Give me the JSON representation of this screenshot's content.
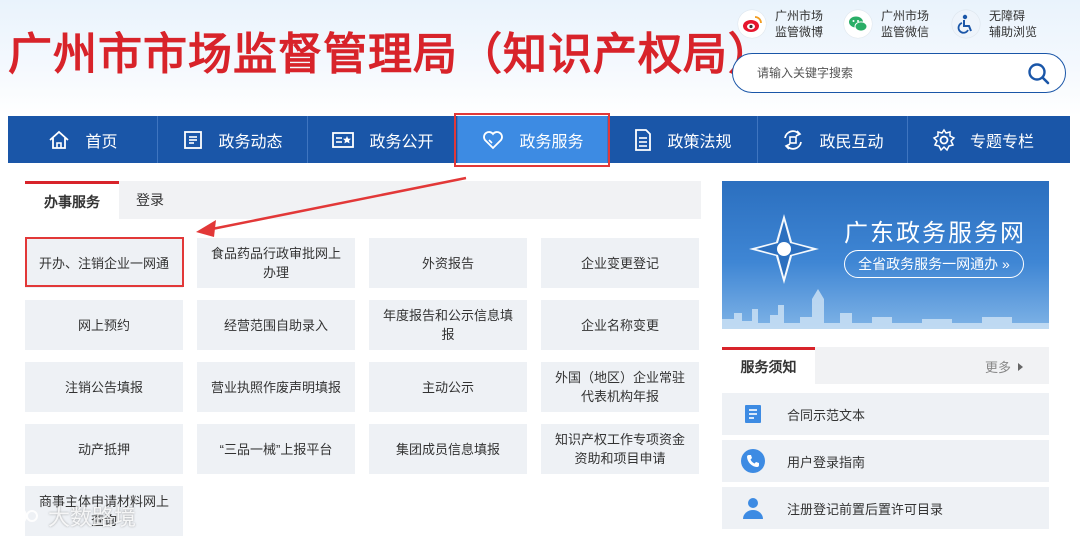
{
  "header": {
    "site_title": "广州市市场监督管理局（知识产权局）",
    "links": [
      {
        "line1": "广州市场",
        "line2": "监管微博",
        "icon": "weibo-icon"
      },
      {
        "line1": "广州市场",
        "line2": "监管微信",
        "icon": "wechat-icon"
      },
      {
        "line1": "无障碍",
        "line2": "辅助浏览",
        "icon": "accessibility-icon"
      }
    ],
    "search_placeholder": "请输入关键字搜索"
  },
  "nav": {
    "items": [
      {
        "label": "首页",
        "icon": "home-icon"
      },
      {
        "label": "政务动态",
        "icon": "news-icon"
      },
      {
        "label": "政务公开",
        "icon": "publicity-icon"
      },
      {
        "label": "政务服务",
        "icon": "heart-icon",
        "active": true
      },
      {
        "label": "政策法规",
        "icon": "document-icon"
      },
      {
        "label": "政民互动",
        "icon": "interaction-icon"
      },
      {
        "label": "专题专栏",
        "icon": "gear-icon"
      }
    ]
  },
  "service": {
    "tabs": [
      {
        "label": "办事服务",
        "active": true
      },
      {
        "label": "登录",
        "active": false
      }
    ],
    "grid": [
      "开办、注销企业一网通",
      "食品药品行政审批网上办理",
      "外资报告",
      "企业变更登记",
      "网上预约",
      "经营范围自助录入",
      "年度报告和公示信息填报",
      "企业名称变更",
      "注销公告填报",
      "营业执照作废声明填报",
      "主动公示",
      "外国（地区）企业常驻代表机构年报",
      "动产抵押",
      "“三品一械”上报平台",
      "集团成员信息填报",
      "知识产权工作专项资金资助和项目申请",
      "商事主体申请材料网上查询"
    ]
  },
  "banner": {
    "title": "广东政务服务网",
    "subtitle": "全省政务服务一网通办 »"
  },
  "notice": {
    "title": "服务须知",
    "more": "更多",
    "items": [
      {
        "label": "合同示范文本",
        "icon": "contract-icon"
      },
      {
        "label": "用户登录指南",
        "icon": "phone-icon"
      },
      {
        "label": "注册登记前置后置许可目录",
        "icon": "user-icon"
      }
    ]
  },
  "watermark": "大数路境",
  "colors": {
    "title_red": "#d8232a",
    "nav_blue": "#1a56a8",
    "nav_active": "#3d8be3",
    "annotation_red": "#e23838"
  }
}
